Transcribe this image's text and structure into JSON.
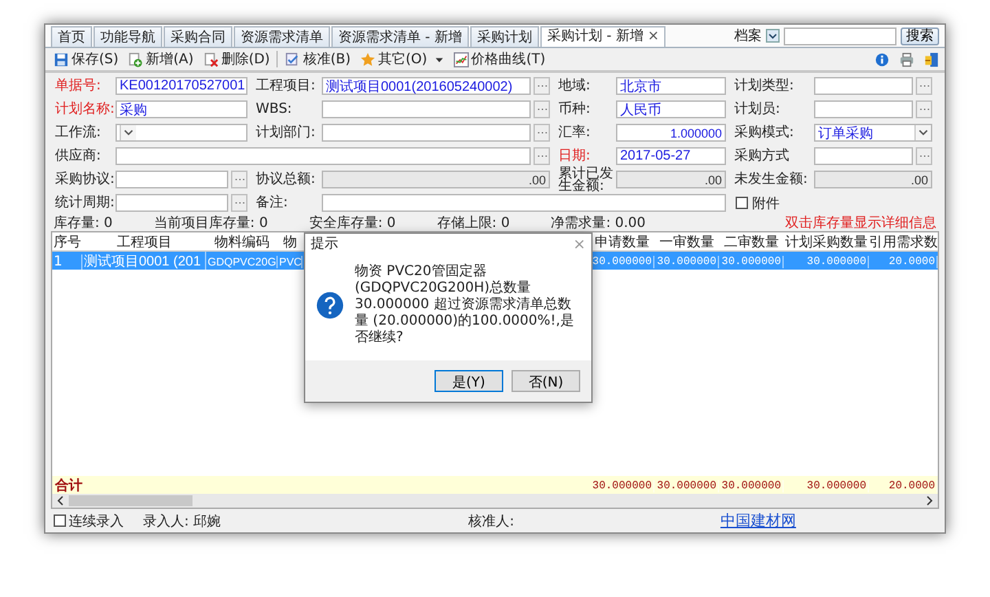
{
  "tabs": [
    {
      "label": "首页",
      "selected": false
    },
    {
      "label": "功能导航",
      "selected": false
    },
    {
      "label": "采购合同",
      "selected": false
    },
    {
      "label": "资源需求清单",
      "selected": false
    },
    {
      "label": "资源需求清单 - 新增",
      "selected": false
    },
    {
      "label": "采购计划",
      "selected": false
    },
    {
      "label": "采购计划 - 新增",
      "selected": true,
      "close": "×"
    }
  ],
  "search": {
    "scope": "档案",
    "button": "搜索"
  },
  "toolbar": [
    {
      "label": "保存(S)",
      "kind": "save"
    },
    {
      "label": "新增(A)",
      "kind": "add"
    },
    {
      "label": "删除(D)",
      "kind": "delete"
    },
    {
      "label": "核准(B)",
      "kind": "approve"
    },
    {
      "label": "其它(O)",
      "kind": "menu"
    },
    {
      "label": "价格曲线(T)",
      "kind": "chart"
    }
  ],
  "form": {
    "fields": [
      {
        "label": "单据号:",
        "required": true,
        "kind": "text",
        "value": "KE00120170527001"
      },
      {
        "label": "工程项目:",
        "required": false,
        "kind": "lookup",
        "value": "测试项目0001(201605240002)"
      },
      {
        "label": "地域:",
        "required": false,
        "kind": "text",
        "value": "北京市"
      },
      {
        "label": "计划类型:",
        "required": false,
        "kind": "lookup"
      },
      {
        "label": "计划名称:",
        "required": true,
        "kind": "text",
        "value": "采购"
      },
      {
        "label": "WBS:",
        "required": false,
        "kind": "lookup"
      },
      {
        "label": "币种:",
        "required": false,
        "kind": "text",
        "value": "人民币"
      },
      {
        "label": "计划员:",
        "required": false,
        "kind": "lookup"
      },
      {
        "label": "工作流:",
        "required": false,
        "kind": "dropdown"
      },
      {
        "label": "计划部门:",
        "required": false,
        "kind": "lookup"
      },
      {
        "label": "汇率:",
        "required": false,
        "kind": "number",
        "value": "1.000000"
      },
      {
        "label": "采购模式:",
        "required": false,
        "kind": "dropdown",
        "value": "订单采购"
      },
      {
        "label": "供应商:",
        "required": false,
        "kind": "wide-lookup"
      },
      {
        "label": "日期:",
        "required": true,
        "kind": "text",
        "value": "2017-05-27"
      },
      {
        "label": "采购方式",
        "required": false,
        "kind": "lookup"
      },
      {
        "label": "采购协议:",
        "required": false,
        "kind": "lookup"
      },
      {
        "label": "协议总额:",
        "required": false,
        "kind": "readonly",
        "value": ".00"
      },
      {
        "label": "累计已发生金额:",
        "required": false,
        "kind": "readonly",
        "value": ".00"
      },
      {
        "label": "未发生金额:",
        "required": false,
        "kind": "readonly",
        "value": ".00"
      },
      {
        "label": "统计周期:",
        "required": false,
        "kind": "lookup"
      },
      {
        "label": "备注:",
        "required": false,
        "kind": "wide-text"
      },
      {
        "label": "附件",
        "kind": "checkbox",
        "checked": false
      }
    ]
  },
  "stats": [
    "库存量: 0",
    "当前项目库存量: 0",
    "安全库存量: 0",
    "存储上限: 0",
    "净需求量: 0.00"
  ],
  "hint": "双击库存量显示详细信息",
  "table": {
    "columns": [
      "序号",
      "工程项目",
      "物料编码",
      "物",
      "申请数量",
      "一审数量",
      "二审数量",
      "计划采购数量",
      "引用需求数"
    ],
    "rows": [
      {
        "selected": true,
        "cells": [
          "1",
          "测试项目0001 (201",
          "GDQPVC20G",
          "PVC",
          "30.000000",
          "30.000000",
          "30.000000",
          "30.000000",
          "20.0000"
        ]
      }
    ],
    "totals": {
      "label": "合计",
      "values": [
        "30.000000",
        "30.000000",
        "30.000000",
        "30.000000",
        "20.0000"
      ]
    }
  },
  "footer": {
    "continuous": {
      "label": "连续录入",
      "checked": false
    },
    "entered_by": "录入人: 邱婉",
    "approver": "核准人:",
    "link": "中国建材网"
  },
  "dialog": {
    "title": "提示",
    "close": "×",
    "message": "物资 PVC20管固定器(GDQPVC20G200H)总数量 30.000000 超过资源需求清单总数量 (20.000000)的100.0000%!,是否继续?",
    "buttons": [
      {
        "label": "是(Y)",
        "selected": true
      },
      {
        "label": "否(N)",
        "selected": false
      }
    ]
  }
}
